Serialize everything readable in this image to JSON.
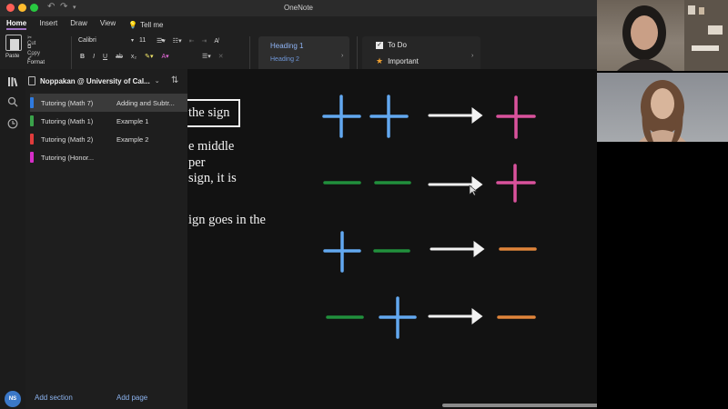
{
  "window": {
    "title": "OneNote"
  },
  "ribbon": {
    "tabs": [
      "Home",
      "Insert",
      "Draw",
      "View"
    ],
    "tell_me": "Tell me",
    "clipboard": {
      "paste": "Paste",
      "cut": "Cut",
      "copy": "Copy",
      "format": "Format"
    },
    "font_name": "Calibri",
    "font_size": "11",
    "styles": {
      "heading1": "Heading 1",
      "heading2": "Heading 2"
    },
    "tags": {
      "todo": "To Do",
      "important": "Important"
    }
  },
  "navigation": {
    "notebook": "Noppakan @ University of Cal...",
    "sections": [
      {
        "label": "Tutoring (Math 7)",
        "color": "#2f7be0"
      },
      {
        "label": "Tutoring (Math 1)",
        "color": "#3aa24a"
      },
      {
        "label": "Tutoring (Math 2)",
        "color": "#e03c3c"
      },
      {
        "label": "Tutoring (Honor...",
        "color": "#d62ec8"
      }
    ],
    "pages": [
      "Adding and Subtr...",
      "Example 1",
      "Example 2"
    ],
    "add_section": "Add section",
    "add_page": "Add page",
    "user_initials": "NS"
  },
  "note": {
    "boxed_text": "the sign",
    "lines": [
      "e middle",
      "per",
      "sign, it is",
      "ign goes in the"
    ]
  },
  "colors": {
    "plus_blue": "#62a8f0",
    "plus_pink": "#d9529c",
    "minus_green": "#21903c",
    "minus_orange": "#e0843a",
    "arrow": "#f2f2f2"
  }
}
